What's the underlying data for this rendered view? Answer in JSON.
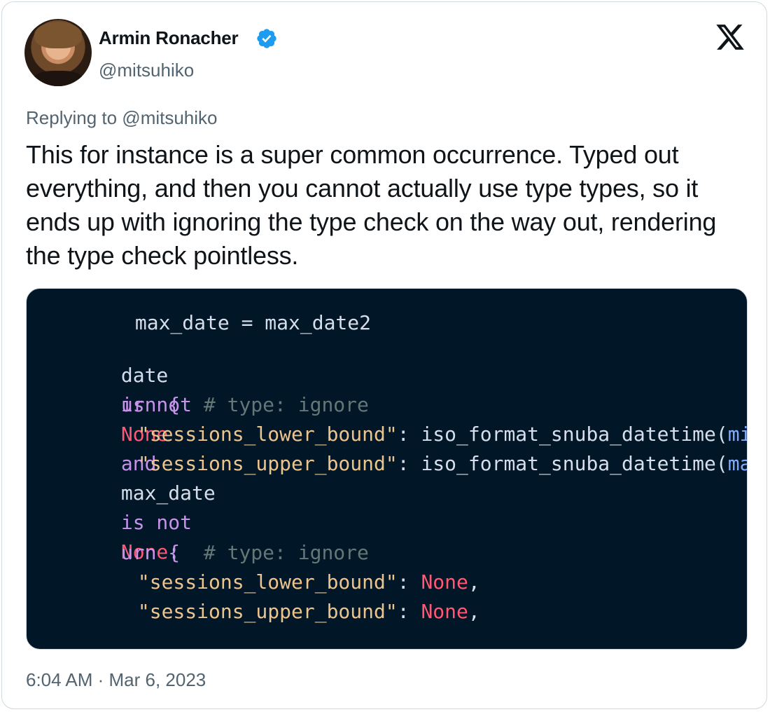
{
  "author": {
    "name": "Armin Ronacher",
    "handle": "@mitsuhiko",
    "verified_color": "#1d9bf0"
  },
  "platform_icon": "x-logo-icon",
  "tweet": {
    "replying_to": "Replying to @mitsuhiko",
    "text": "This for instance is a super common occurrence. Typed out everything, and then you cannot actually use type types, so it ends up with ignoring the type check on the way out, rendering the type check pointless.",
    "timestamp": "6:04 AM · Mar 6, 2023"
  },
  "code_image": {
    "background": "#011627",
    "lines": {
      "l0": "max_date = max_date2",
      "l1_a": "date",
      "l1_b": "is not",
      "l1_c": "None",
      "l1_d": "and",
      "l1_e": "max_date",
      "l1_f": "is not",
      "l1_g": "None",
      "l1_h": ":",
      "l2_a": "urn {",
      "l2_b": "# type: ignore",
      "l3_a": "\"sessions_lower_bound\"",
      "l3_b": ": iso_format_snuba_datetime(",
      "l3_c": "min_dat",
      "l4_a": "\"sessions_upper_bound\"",
      "l4_b": ": iso_format_snuba_datetime(",
      "l4_c": "max_dat",
      "l5_a": "urn {",
      "l5_b": "# type: ignore",
      "l6_a": "\"sessions_lower_bound\"",
      "l6_b": ": ",
      "l6_c": "None",
      "l6_d": ",",
      "l7_a": "\"sessions_upper_bound\"",
      "l7_b": ": ",
      "l7_c": "None",
      "l7_d": ","
    }
  }
}
